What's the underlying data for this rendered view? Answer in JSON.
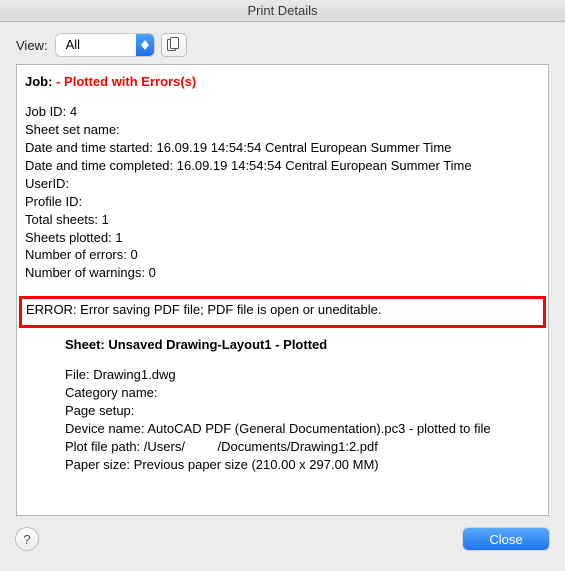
{
  "window": {
    "title": "Print Details"
  },
  "toolbar": {
    "view_label": "View:",
    "view_value": "All"
  },
  "job": {
    "label": "Job:",
    "status_prefix": "- ",
    "status": "Plotted with Errors(s)",
    "fields": {
      "job_id_label": "Job ID:",
      "job_id": "4",
      "sheet_set_label": "Sheet set name:",
      "sheet_set": "",
      "start_label": "Date and time started:",
      "start": "16.09.19 14:54:54 Central European Summer Time",
      "complete_label": "Date and time completed:",
      "complete": "16.09.19 14:54:54 Central European Summer Time",
      "userid_label": "UserID:",
      "userid": "",
      "profile_label": "Profile ID:",
      "profile": "",
      "total_sheets_label": "Total sheets:",
      "total_sheets": "1",
      "plotted_label": "Sheets plotted:",
      "plotted": "1",
      "errors_label": "Number of errors:",
      "errors": "0",
      "warnings_label": "Number of warnings:",
      "warnings": "0"
    }
  },
  "error_message": "ERROR: Error saving PDF file; PDF file is open or uneditable.",
  "sheet": {
    "title": "Sheet: Unsaved Drawing-Layout1 - Plotted",
    "file_label": "File:",
    "file": "Drawing1.dwg",
    "category_label": "Category name:",
    "category": "",
    "page_setup_label": "Page setup:",
    "page_setup": "",
    "device_label": "Device name:",
    "device": "AutoCAD PDF (General Documentation).pc3 - plotted to file",
    "plot_path_label": "Plot file path:",
    "plot_path": "/Users/         /Documents/Drawing1:2.pdf",
    "paper_label": "Paper size:",
    "paper": "Previous paper size (210.00 x 297.00 MM)"
  },
  "footer": {
    "close": "Close"
  }
}
